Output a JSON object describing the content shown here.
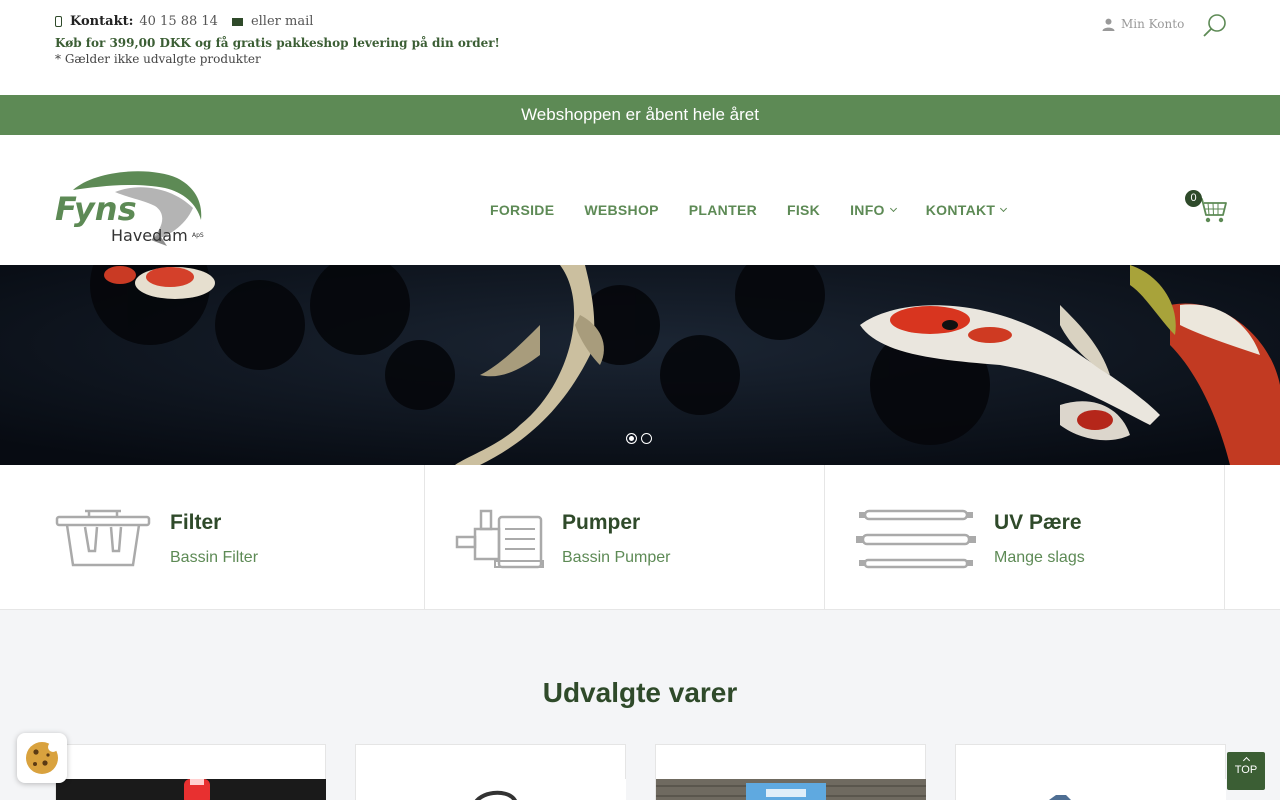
{
  "topbar": {
    "contact_label": "Kontakt:",
    "phone": "40 15 88 14",
    "mail_label": "eller mail",
    "promo": "Køb for 399,00 DKK og få gratis pakkeshop levering på din order!",
    "note": "* Gælder ikke udvalgte produkter",
    "account": "Min Konto"
  },
  "banner": {
    "text": "Webshoppen er åbent hele året"
  },
  "logo": {
    "word1": "Fyns",
    "word2": "Havedam",
    "suffix": "ApS"
  },
  "nav": {
    "items": [
      {
        "label": "FORSIDE"
      },
      {
        "label": "WEBSHOP"
      },
      {
        "label": "PLANTER"
      },
      {
        "label": "FISK"
      },
      {
        "label": "INFO"
      },
      {
        "label": "KONTAKT"
      }
    ]
  },
  "cart": {
    "count": "0"
  },
  "hero": {
    "slide_count": 2,
    "active_slide": 1
  },
  "categories": [
    {
      "title": "Filter",
      "subtitle": "Bassin Filter",
      "icon": "filter-icon"
    },
    {
      "title": "Pumper",
      "subtitle": "Bassin Pumper",
      "icon": "pump-icon"
    },
    {
      "title": "UV Pære",
      "subtitle": "Mange slags",
      "icon": "uv-lamp-icon"
    }
  ],
  "featured": {
    "heading": "Udvalgte varer"
  },
  "top_button": {
    "label": "TOP"
  },
  "colors": {
    "brand_green": "#5d8a55",
    "dark_green": "#2f4a2a",
    "hero_bg": "#0e1420"
  }
}
